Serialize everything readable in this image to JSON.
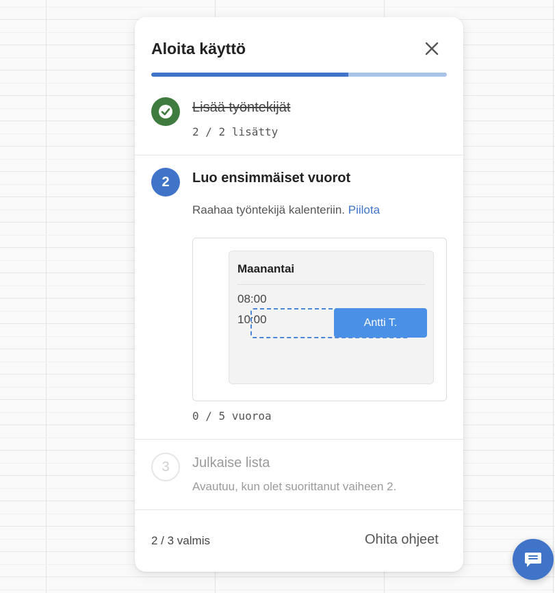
{
  "panel": {
    "title": "Aloita käyttö",
    "progress_fraction": 0.667
  },
  "steps": [
    {
      "number": "1",
      "title": "Lisää työntekijät",
      "status_text": "2 / 2 lisätty",
      "state": "done"
    },
    {
      "number": "2",
      "title": "Luo ensimmäiset vuorot",
      "description": "Raahaa työntekijä kalenteriin.",
      "hide_link": "Piilota",
      "demo": {
        "day": "Maanantai",
        "times": [
          "08:00",
          "10:00"
        ],
        "employee_chip": "Antti T."
      },
      "status_text": "0 / 5 vuoroa",
      "state": "active"
    },
    {
      "number": "3",
      "title": "Julkaise lista",
      "description": "Avautuu, kun olet suorittanut vaiheen 2.",
      "state": "locked"
    }
  ],
  "footer": {
    "count": "2 / 3 valmis",
    "skip_label": "Ohita ohjeet"
  },
  "icons": {
    "close": "close-icon",
    "check": "check-icon",
    "chat": "chat-icon"
  },
  "colors": {
    "accent": "#3f74c9",
    "done": "#3f7a3f",
    "chip": "#4a90e6"
  }
}
